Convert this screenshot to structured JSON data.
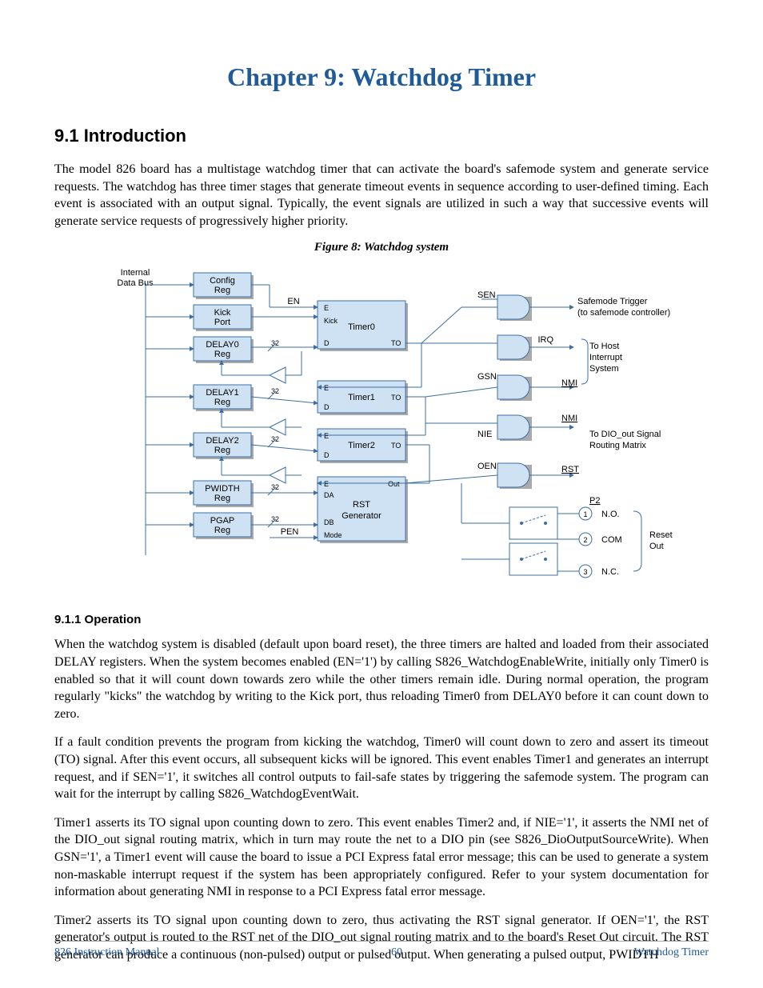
{
  "chapter_title": "Chapter 9: Watchdog Timer",
  "section": "9.1  Introduction",
  "intro_para": "The model 826 board has a multistage watchdog timer that can activate the board's safemode system and generate service requests. The watchdog has three timer stages that generate timeout events in sequence according to user-defined timing. Each event is associated with an output signal. Typically, the event signals are utilized in such a way that successive events will generate service requests of progressively higher priority.",
  "figure_caption": "Figure 8: Watchdog system",
  "diagram": {
    "internal_data_bus_l1": "Internal",
    "internal_data_bus_l2": "Data Bus",
    "regs": {
      "config": "Config Reg",
      "kick": "Kick Port",
      "delay0": "DELAY0 Reg",
      "delay1": "DELAY1 Reg",
      "delay2": "DELAY2 Reg",
      "pwidth": "PWIDTH Reg",
      "pgap": "PGAP Reg"
    },
    "bits32": "32",
    "timers": {
      "t0": "Timer0",
      "t1": "Timer1",
      "t2": "Timer2"
    },
    "rstgen": "RST Generator",
    "pins": {
      "E": "E",
      "D": "D",
      "TO": "TO",
      "Out": "Out",
      "EN": "EN",
      "Kick": "Kick",
      "DA": "DA",
      "DB": "DB",
      "Mode": "Mode",
      "PEN": "PEN"
    },
    "signals": {
      "SEN": "SEN",
      "IRQ": "IRQ",
      "GSN": "GSN",
      "NMI": "NMI",
      "NIE": "NIE",
      "OEN": "OEN",
      "RST": "RST"
    },
    "outputs": {
      "safemode_l1": "Safemode Trigger",
      "safemode_l2": "(to safemode controller)",
      "host_l1": "To Host",
      "host_l2": "Interrupt",
      "host_l3": "System",
      "dio_l1": "To DIO_out Signal",
      "dio_l2": "Routing Matrix",
      "reset_l1": "Reset",
      "reset_l2": "Out",
      "p2": "P2",
      "no": "N.O.",
      "com": "COM",
      "nc": "N.C.",
      "pin1": "1",
      "pin2": "2",
      "pin3": "3"
    }
  },
  "subsection": "9.1.1   Operation",
  "op_p1": "When the watchdog system is disabled (default upon board reset), the three timers are halted and loaded from their associated DELAY registers. When the system becomes enabled (EN='1') by calling S826_WatchdogEnableWrite, initially only Timer0 is enabled so that it will count down towards zero while the other timers remain idle. During normal operation, the program regularly \"kicks\" the watchdog by writing to the Kick port, thus reloading Timer0 from DELAY0 before it can count down to zero.",
  "op_p2": "If a fault condition prevents the program from kicking the watchdog, Timer0 will count down to zero and assert its timeout (TO) signal. After this event occurs, all subsequent kicks will be ignored. This event enables Timer1 and generates an interrupt request, and if SEN='1', it switches all control outputs to fail-safe states by triggering the safemode system. The program can wait for the interrupt by calling S826_WatchdogEventWait.",
  "op_p3": "Timer1 asserts its TO signal upon counting down to zero. This event enables Timer2 and, if NIE='1', it asserts the NMI net of the DIO_out signal routing matrix, which in turn may route the net to a DIO pin (see S826_DioOutputSourceWrite). When GSN='1', a Timer1 event will cause the board to issue a PCI Express fatal error message; this can be used to generate a system non-maskable interrupt request if the system has been appropriately configured. Refer to your system documentation for information about generating NMI in response to a PCI Express fatal error message.",
  "op_p4": "Timer2 asserts its TO signal upon counting down to zero, thus activating the RST signal generator. If OEN='1', the RST generator's output is routed to the RST net of the DIO_out signal routing matrix and to the board's Reset Out circuit. The RST generator can produce a continuous (non-pulsed) output or pulsed output. When generating a pulsed output, PWIDTH",
  "footer": {
    "left": "826 Instruction Manual",
    "center": "60",
    "right": "Watchdog Timer"
  }
}
